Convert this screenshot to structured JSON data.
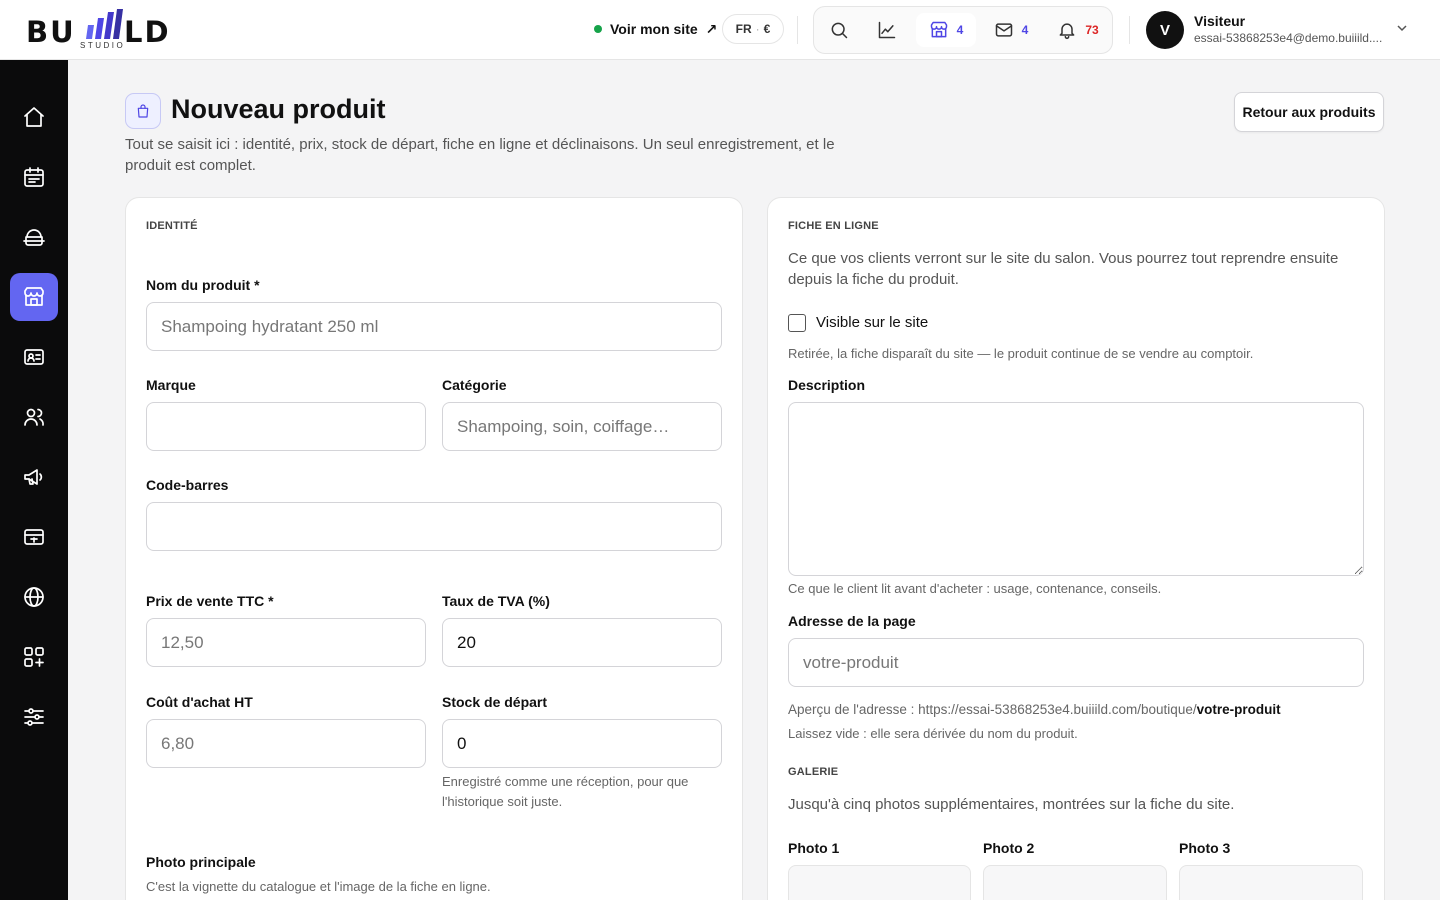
{
  "header": {
    "logo_main": "BU",
    "logo_end": "LD",
    "logo_sub": "STUDIO",
    "view_site": "Voir mon site",
    "view_site_arrow": "↗",
    "lang": "FR",
    "lang_sep": "·",
    "currency": "€",
    "tools": {
      "store_count": "4",
      "mail_count": "4",
      "notif_count": "73"
    },
    "user": {
      "initial": "V",
      "name": "Visiteur",
      "email": "essai-53868253e4@demo.buiiild...."
    }
  },
  "colors": {
    "accent": "#6366f1",
    "badge_blue": "#4f46e5",
    "badge_red": "#dc2626",
    "online": "#16a34a"
  },
  "sidebar": {
    "items": [
      {
        "icon": "home-icon"
      },
      {
        "icon": "calendar-icon"
      },
      {
        "icon": "services-icon"
      },
      {
        "icon": "store-icon",
        "active": true
      },
      {
        "icon": "contact-card-icon"
      },
      {
        "icon": "users-icon"
      },
      {
        "icon": "megaphone-icon"
      },
      {
        "icon": "payment-icon"
      },
      {
        "icon": "globe-icon"
      },
      {
        "icon": "apps-add-icon"
      },
      {
        "icon": "settings-sliders-icon"
      }
    ]
  },
  "page": {
    "title": "Nouveau produit",
    "subtitle": "Tout se saisit ici : identité, prix, stock de départ, fiche en ligne et déclinaisons. Un seul enregistrement, et le produit est complet.",
    "back_button": "Retour aux produits"
  },
  "identity": {
    "section": "IDENTITÉ",
    "name_label": "Nom du produit *",
    "name_placeholder": "Shampoing hydratant 250 ml",
    "brand_label": "Marque",
    "brand_value": "",
    "category_label": "Catégorie",
    "category_placeholder": "Shampoing, soin, coiffage…",
    "barcode_label": "Code-barres",
    "barcode_value": "",
    "price_label": "Prix de vente TTC *",
    "price_placeholder": "12,50",
    "vat_label": "Taux de TVA (%)",
    "vat_value": "20",
    "cost_label": "Coût d'achat HT",
    "cost_placeholder": "6,80",
    "stock_label": "Stock de départ",
    "stock_value": "0",
    "stock_hint": "Enregistré comme une réception, pour que l'historique soit juste.",
    "photo_label": "Photo principale",
    "photo_hint": "C'est la vignette du catalogue et l'image de la fiche en ligne."
  },
  "online": {
    "section": "FICHE EN LIGNE",
    "intro": "Ce que vos clients verront sur le site du salon. Vous pourrez tout reprendre ensuite depuis la fiche du produit.",
    "visible_label": "Visible sur le site",
    "visible_checked": false,
    "visible_hint": "Retirée, la fiche disparaît du site — le produit continue de se vendre au comptoir.",
    "description_label": "Description",
    "description_value": "",
    "description_hint": "Ce que le client lit avant d'acheter : usage, contenance, conseils.",
    "slug_label": "Adresse de la page",
    "slug_placeholder": "votre-produit",
    "preview_prefix": "Aperçu de l'adresse : https://essai-53868253e4.buiiild.com/boutique/",
    "preview_slug": "votre-produit",
    "slug_hint": "Laissez vide : elle sera dérivée du nom du produit.",
    "gallery_section": "GALERIE",
    "gallery_intro": "Jusqu'à cinq photos supplémentaires, montrées sur la fiche du site.",
    "photos": [
      "Photo 1",
      "Photo 2",
      "Photo 3"
    ]
  }
}
